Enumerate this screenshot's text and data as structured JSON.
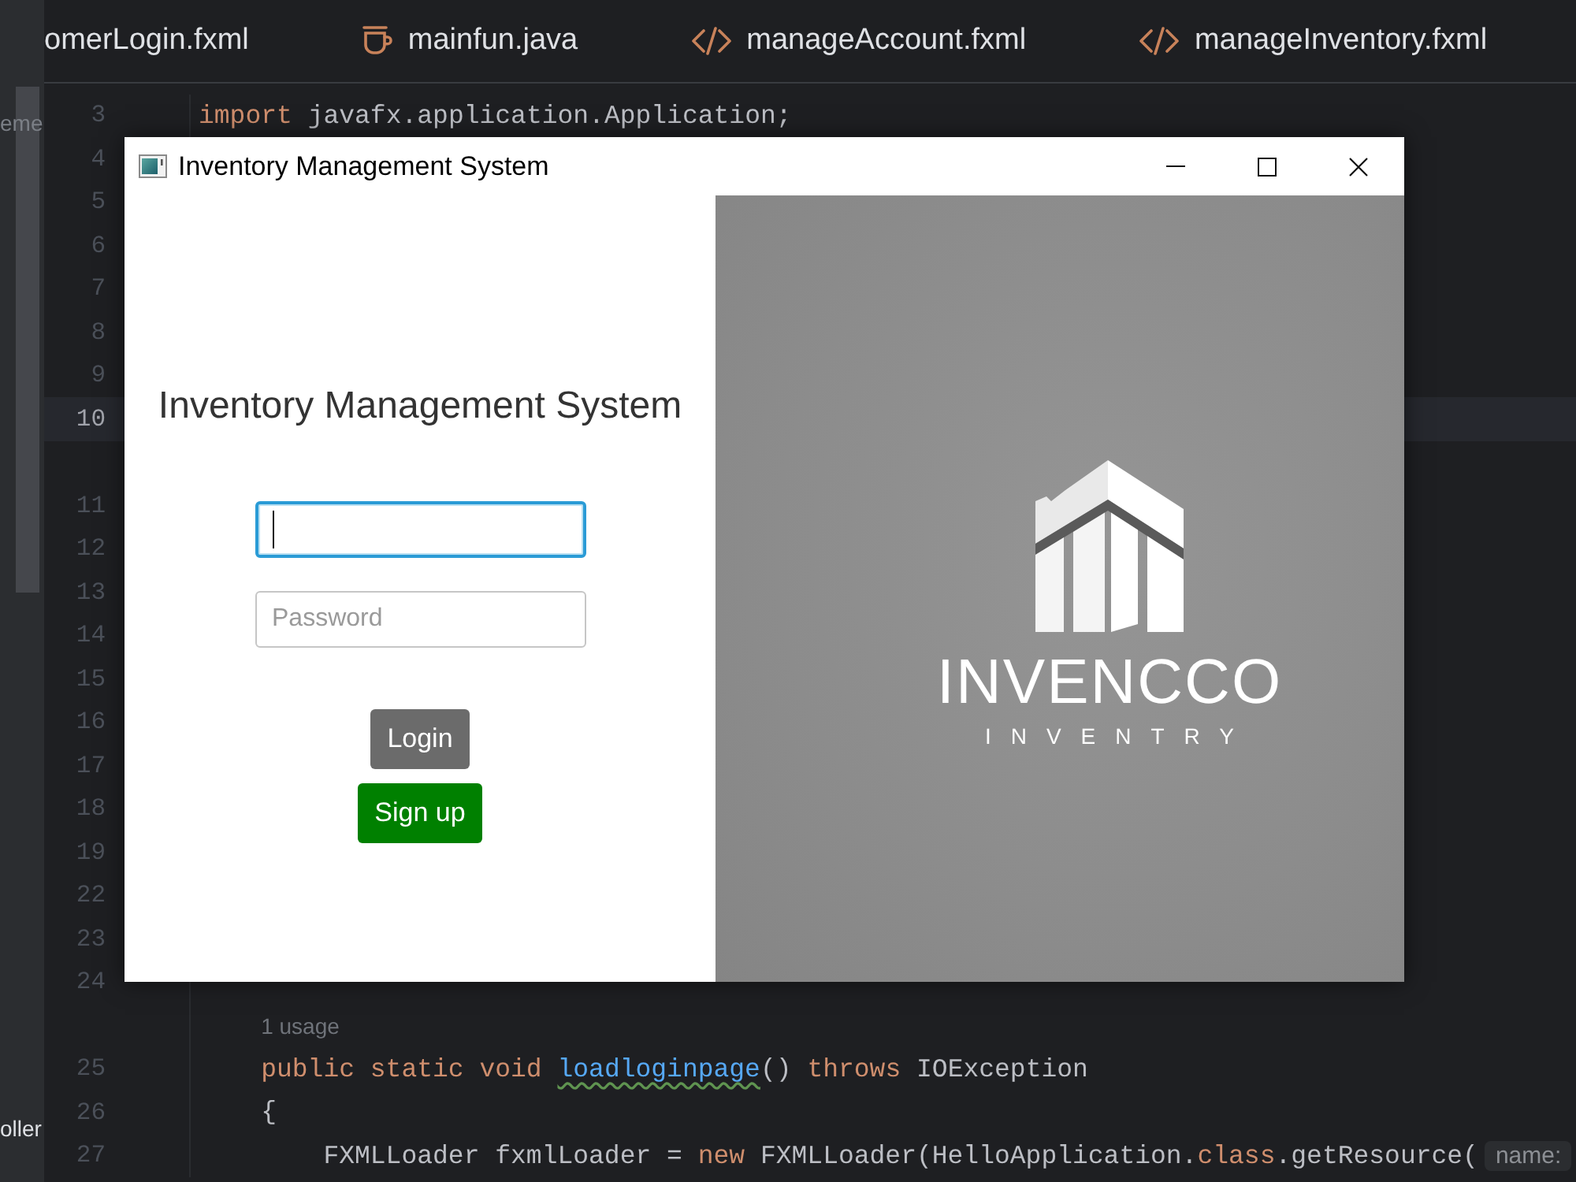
{
  "ide": {
    "tabs": [
      {
        "label": "omerLogin.fxml"
      },
      {
        "label": "mainfun.java",
        "kind": "java"
      },
      {
        "label": "manageAccount.fxml",
        "kind": "fxml"
      },
      {
        "label": "manageInventory.fxml",
        "kind": "fxml"
      }
    ],
    "project_panel": {
      "items": [
        {
          "text": "eme",
          "dimmed": true
        },
        {
          "text": "oller",
          "dimmed": false
        }
      ]
    },
    "editor": {
      "lines": [
        {
          "number": "3",
          "current": false,
          "code": [
            {
              "kind": "keyword",
              "text": "import"
            },
            {
              "kind": "plain",
              "text": " javafx.application.Application;"
            }
          ]
        },
        {
          "number": "4",
          "current": false
        },
        {
          "number": "5",
          "current": false
        },
        {
          "number": "6",
          "current": false
        },
        {
          "number": "7",
          "current": false
        },
        {
          "number": "8",
          "current": false
        },
        {
          "number": "9",
          "current": false
        },
        {
          "number": "10",
          "current": true
        },
        {
          "number": "11",
          "current": false,
          "inlay_row": true
        },
        {
          "number": "12",
          "current": false
        },
        {
          "number": "13",
          "current": false
        },
        {
          "number": "14",
          "current": false
        },
        {
          "number": "15",
          "current": false
        },
        {
          "number": "16",
          "current": false
        },
        {
          "number": "17",
          "current": false
        },
        {
          "number": "18",
          "current": false
        },
        {
          "number": "19",
          "current": false
        },
        {
          "number": "22",
          "current": false
        },
        {
          "number": "23",
          "current": false
        },
        {
          "number": "24",
          "current": false
        },
        {
          "number": "25",
          "current": false,
          "usages": "1 usage",
          "code": [
            {
              "kind": "keyword",
              "text": "    public static void "
            },
            {
              "kind": "method",
              "text": "loadloginpage",
              "typo": true
            },
            {
              "kind": "plain",
              "text": "() "
            },
            {
              "kind": "keyword",
              "text": "throws"
            },
            {
              "kind": "plain",
              "text": " IOException"
            }
          ]
        },
        {
          "number": "26",
          "current": false,
          "code": [
            {
              "kind": "plain",
              "text": "    {"
            }
          ]
        },
        {
          "number": "27",
          "current": false,
          "code": [
            {
              "kind": "plain",
              "text": "        FXMLLoader fxmlLoader = "
            },
            {
              "kind": "keyword",
              "text": "new"
            },
            {
              "kind": "plain",
              "text": " FXMLLoader(HelloApplication."
            },
            {
              "kind": "keyword",
              "text": "class"
            },
            {
              "kind": "plain",
              "text": ".getResource("
            }
          ],
          "param_hint": "name:"
        }
      ]
    }
  },
  "dialog": {
    "title": "Inventory Management System",
    "heading": "Inventory Management System",
    "fields": [
      {
        "focused": true
      },
      {
        "placeholder": "Password",
        "focused": false
      }
    ],
    "buttons": [
      {
        "label": "Login",
        "color": "#6b6b6b"
      },
      {
        "label": "Sign up",
        "color": "#008000"
      }
    ],
    "logo": {
      "wordmark": "INVENCCO",
      "tagline": "INVENTRY"
    }
  }
}
